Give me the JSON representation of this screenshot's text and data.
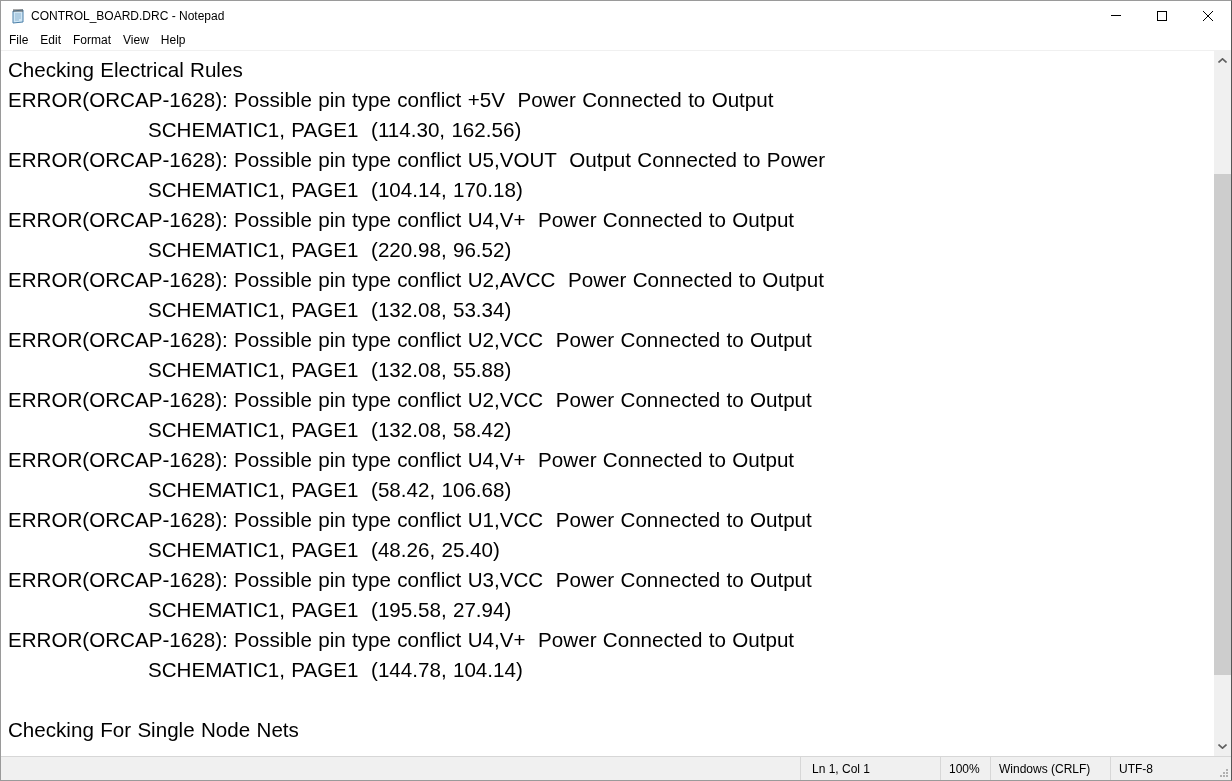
{
  "window": {
    "title": "CONTROL_BOARD.DRC - Notepad"
  },
  "menu": [
    "File",
    "Edit",
    "Format",
    "View",
    "Help"
  ],
  "document": {
    "sections": [
      {
        "heading": "Checking Electrical Rules",
        "errors": [
          {
            "message": "ERROR(ORCAP-1628): Possible pin type conflict +5V  Power Connected to Output",
            "location": "SCHEMATIC1, PAGE1  (114.30, 162.56)"
          },
          {
            "message": "ERROR(ORCAP-1628): Possible pin type conflict U5,VOUT  Output Connected to Power",
            "location": "SCHEMATIC1, PAGE1  (104.14, 170.18)"
          },
          {
            "message": "ERROR(ORCAP-1628): Possible pin type conflict U4,V+  Power Connected to Output",
            "location": "SCHEMATIC1, PAGE1  (220.98, 96.52)"
          },
          {
            "message": "ERROR(ORCAP-1628): Possible pin type conflict U2,AVCC  Power Connected to Output",
            "location": "SCHEMATIC1, PAGE1  (132.08, 53.34)"
          },
          {
            "message": "ERROR(ORCAP-1628): Possible pin type conflict U2,VCC  Power Connected to Output",
            "location": "SCHEMATIC1, PAGE1  (132.08, 55.88)"
          },
          {
            "message": "ERROR(ORCAP-1628): Possible pin type conflict U2,VCC  Power Connected to Output",
            "location": "SCHEMATIC1, PAGE1  (132.08, 58.42)"
          },
          {
            "message": "ERROR(ORCAP-1628): Possible pin type conflict U4,V+  Power Connected to Output",
            "location": "SCHEMATIC1, PAGE1  (58.42, 106.68)"
          },
          {
            "message": "ERROR(ORCAP-1628): Possible pin type conflict U1,VCC  Power Connected to Output",
            "location": "SCHEMATIC1, PAGE1  (48.26, 25.40)"
          },
          {
            "message": "ERROR(ORCAP-1628): Possible pin type conflict U3,VCC  Power Connected to Output",
            "location": "SCHEMATIC1, PAGE1  (195.58, 27.94)"
          },
          {
            "message": "ERROR(ORCAP-1628): Possible pin type conflict U4,V+  Power Connected to Output",
            "location": "SCHEMATIC1, PAGE1  (144.78, 104.14)"
          }
        ]
      },
      {
        "heading": "Checking For Single Node Nets"
      }
    ]
  },
  "status_bar": {
    "position": "Ln 1, Col 1",
    "zoom": "100%",
    "line_ending": "Windows (CRLF)",
    "encoding": "UTF-8"
  }
}
